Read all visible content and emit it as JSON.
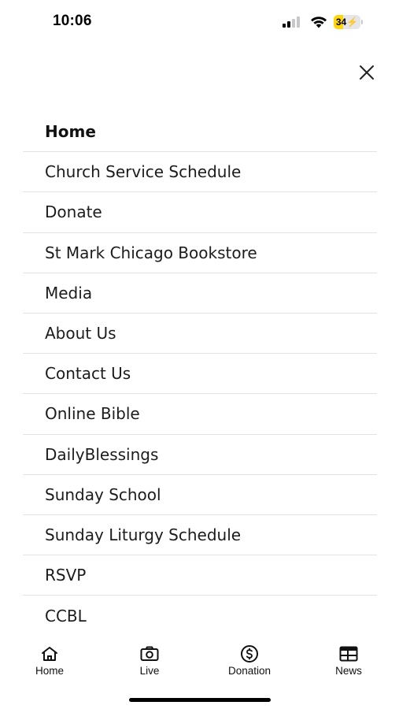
{
  "status_bar": {
    "time": "10:06",
    "battery_level": "34",
    "battery_color": "#ffd60a",
    "icons": [
      "signal-icon",
      "wifi-icon",
      "battery-charging-icon"
    ]
  },
  "menu": {
    "close_icon": "close-icon",
    "items": [
      {
        "label": "Home",
        "active": true
      },
      {
        "label": "Church Service Schedule"
      },
      {
        "label": "Donate"
      },
      {
        "label": "St Mark Chicago Bookstore"
      },
      {
        "label": "Media"
      },
      {
        "label": "About Us"
      },
      {
        "label": "Contact Us"
      },
      {
        "label": "Online Bible"
      },
      {
        "label": "DailyBlessings"
      },
      {
        "label": "Sunday School"
      },
      {
        "label": "Sunday Liturgy Schedule"
      },
      {
        "label": "RSVP"
      },
      {
        "label": "CCBL"
      }
    ]
  },
  "tab_bar": {
    "tabs": [
      {
        "label": "Home",
        "icon": "home-icon"
      },
      {
        "label": "Live",
        "icon": "camera-icon"
      },
      {
        "label": "Donation",
        "icon": "dollar-circle-icon"
      },
      {
        "label": "News",
        "icon": "newspaper-icon"
      }
    ]
  }
}
